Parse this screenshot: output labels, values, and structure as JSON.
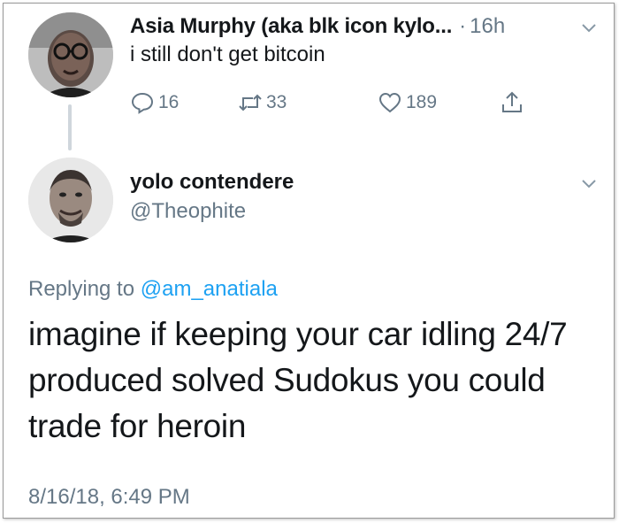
{
  "tweet1": {
    "name": "Asia Murphy (aka blk icon kylo...",
    "separator": "·",
    "time": "16h",
    "text": "i still don't get bitcoin",
    "reply_count": "16",
    "retweet_count": "33",
    "like_count": "189"
  },
  "tweet2": {
    "name": "yolo contendere",
    "handle": "@Theophite",
    "replying_prefix": "Replying to ",
    "replying_to": "@am_anatiala",
    "text_lines": [
      "imagine if keeping your car idling 24/7",
      "produced solved Sudokus you could",
      "trade for heroin"
    ],
    "datetime": "8/16/18, 6:49 PM"
  },
  "colors": {
    "text": "#14171a",
    "muted": "#657786",
    "link": "#1da1f2",
    "thread_line": "#cfd6dc"
  },
  "icons": [
    "reply-icon",
    "retweet-icon",
    "like-icon",
    "share-icon",
    "chevron-down-icon"
  ]
}
